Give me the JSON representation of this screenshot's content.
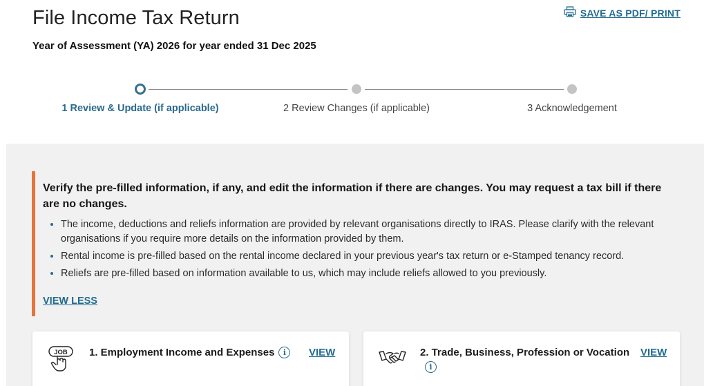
{
  "header": {
    "title": "File Income Tax Return",
    "subtitle": "Year of Assessment (YA) 2026 for year ended 31 Dec 2025",
    "save_link": "SAVE AS PDF/ PRINT",
    "save_icon": "printer-icon"
  },
  "stepper": {
    "steps": [
      {
        "label": "1 Review & Update (if applicable)",
        "state": "active"
      },
      {
        "label": "2 Review Changes (if applicable)",
        "state": "inactive"
      },
      {
        "label": "3 Acknowledgement",
        "state": "inactive"
      }
    ],
    "active_color": "#3a6f8c",
    "inactive_color": "#c4c4c4"
  },
  "notice": {
    "accent_color": "#e8733a",
    "heading": "Verify the pre-filled information, if any, and edit the information if there are changes. You may request a tax bill if there are no changes.",
    "items": [
      "The income, deductions and reliefs information are provided by relevant organisations directly to IRAS. Please clarify with the relevant organisations if you require more details on the information provided by them.",
      "Rental income is pre-filled based on the rental income declared in your previous year's tax return or e-Stamped tenancy record.",
      "Reliefs are pre-filled based on information available to us, which may include reliefs allowed to you previously."
    ],
    "toggle_label": "VIEW LESS"
  },
  "cards": [
    {
      "title": "1. Employment Income and Expenses",
      "icon": "job-hand-icon",
      "view_label": "VIEW",
      "info_icon": "info-icon"
    },
    {
      "title": "2. Trade, Business, Profession or Vocation",
      "icon": "handshake-icon",
      "view_label": "VIEW",
      "info_icon": "info-icon"
    }
  ],
  "colors": {
    "link": "#216b8f",
    "content_bg": "#f1f1f1"
  }
}
